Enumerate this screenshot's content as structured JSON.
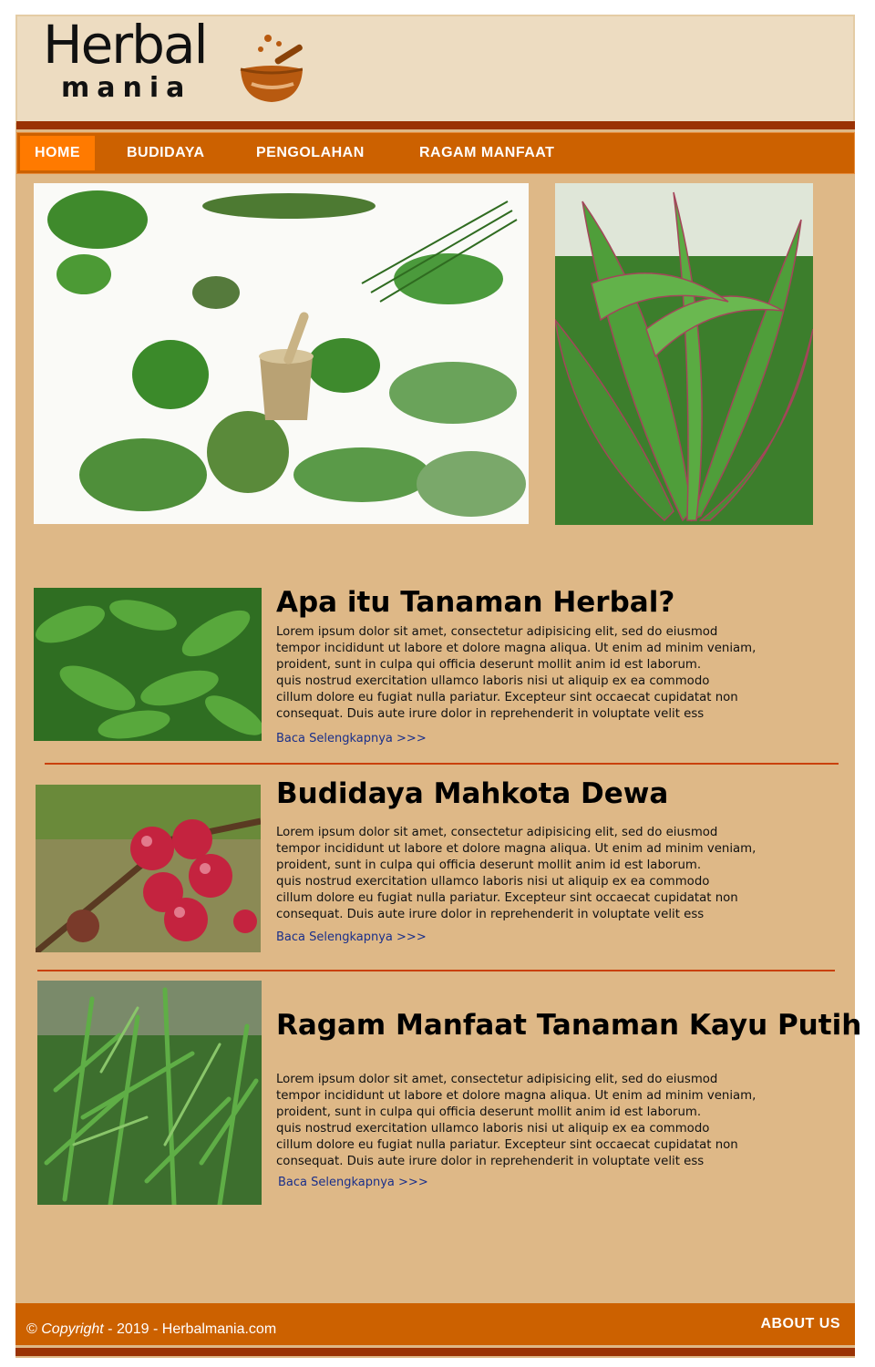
{
  "brand": {
    "logo_top": "Herbal",
    "logo_bottom": "mania"
  },
  "nav": {
    "items": [
      "HOME",
      "BUDIDAYA",
      "PENGOLAHAN",
      "RAGAM MANFAAT"
    ],
    "active": "HOME"
  },
  "articles": [
    {
      "title": "Apa itu Tanaman Herbal?",
      "body": "Lorem ipsum dolor sit amet, consectetur adipisicing elit, sed do eiusmod\ntempor incididunt ut labore et dolore magna aliqua. Ut enim ad minim veniam,\nproident, sunt in culpa qui officia deserunt mollit anim id est laborum.\nquis nostrud exercitation ullamco laboris nisi ut aliquip ex ea commodo\ncillum dolore eu fugiat nulla pariatur. Excepteur sint occaecat cupidatat non\nconsequat. Duis aute irure dolor in reprehenderit in voluptate velit ess",
      "link": "Baca Selengkapnya >>>"
    },
    {
      "title": "Budidaya Mahkota Dewa",
      "body": "Lorem ipsum dolor sit amet, consectetur adipisicing elit, sed do eiusmod\ntempor incididunt ut labore et dolore magna aliqua. Ut enim ad minim veniam,\nproident, sunt in culpa qui officia deserunt mollit anim id est laborum.\nquis nostrud exercitation ullamco laboris nisi ut aliquip ex ea commodo\ncillum dolore eu fugiat nulla pariatur. Excepteur sint occaecat cupidatat non\nconsequat. Duis aute irure dolor in reprehenderit in voluptate velit ess",
      "link": "Baca Selengkapnya >>>"
    },
    {
      "title": "Ragam Manfaat Tanaman Kayu Putih",
      "body": "Lorem ipsum dolor sit amet, consectetur adipisicing elit, sed do eiusmod\ntempor incididunt ut labore et dolore magna aliqua. Ut enim ad minim veniam,\nproident, sunt in culpa qui officia deserunt mollit anim id est laborum.\nquis nostrud exercitation ullamco laboris nisi ut aliquip ex ea commodo\ncillum dolore eu fugiat nulla pariatur. Excepteur sint occaecat cupidatat non\nconsequat. Duis aute irure dolor in reprehenderit in voluptate velit ess",
      "link": "Baca Selengkapnya >>>"
    }
  ],
  "footer": {
    "copyright_symbol": "©",
    "copyright_word": "Copyright",
    "copyright_rest": " - 2019 - Herbalmania.com",
    "about": "ABOUT US"
  },
  "colors": {
    "page_bg": "#deb887",
    "header_bg": "#eddcc1",
    "nav_bg": "#cc6100",
    "nav_active": "#ff7a00",
    "accent_bar": "#9a3204",
    "link": "#1a2f8a"
  }
}
